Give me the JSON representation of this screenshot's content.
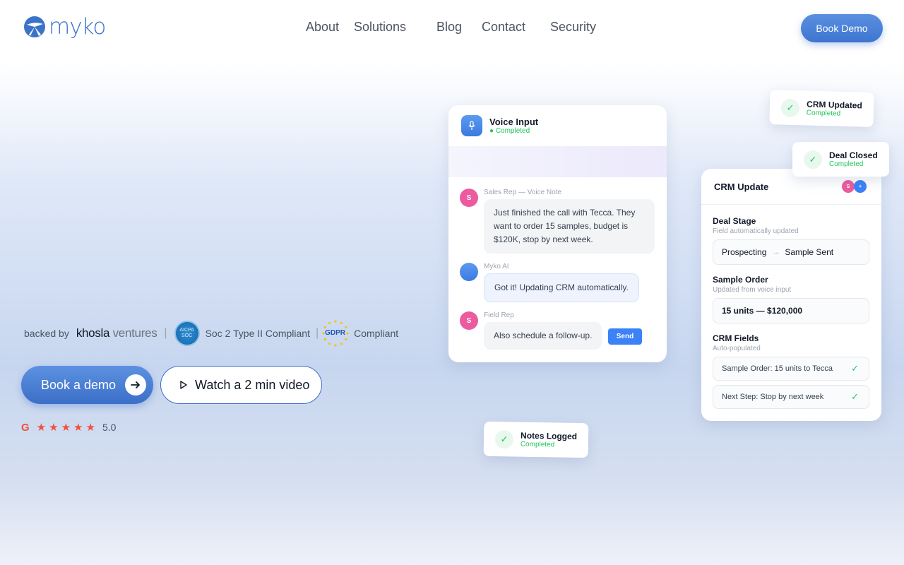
{
  "nav": {
    "logo_text": "myko",
    "items": [
      "About",
      "Solutions",
      "Blog",
      "Contact",
      "Security"
    ],
    "cta": "Book Demo"
  },
  "hero": {
    "backed_by": "backed by",
    "khosla_a": "khosla",
    "khosla_b": "ventures",
    "soc_badge_line1": "AICPA",
    "soc_badge_line2": "SOC",
    "soc_label": "Soc 2  Type  II Compliant",
    "gdpr_badge": "GDPR",
    "gdpr_label": "Compliant",
    "cta_primary": "Book a demo",
    "cta_secondary": "Watch a 2 min video",
    "rating_logo": "G",
    "rating": "5.0",
    "stars": 5
  },
  "chat": {
    "title": "Voice Input",
    "status": "● Completed",
    "messages": [
      {
        "avatar": "S",
        "who": "Sales Rep — Voice Note",
        "text": "Just finished the call with Tecca. They want to order 15 samples, budget is $120K, stop by next week."
      },
      {
        "avatar": "",
        "who": "Myko AI",
        "text": "Got it! Updating CRM automatically."
      },
      {
        "avatar": "S",
        "who": "Field Rep",
        "text": "Also schedule a follow-up."
      }
    ],
    "send": "Send"
  },
  "crm": {
    "title": "CRM Update",
    "avatar_a": "S",
    "avatar_b": "+",
    "deal_stage": {
      "title": "Deal Stage",
      "sub": "Field automatically updated",
      "from": "Prospecting",
      "arrow": "→",
      "to": "Sample Sent"
    },
    "sample_order": {
      "title": "Sample Order",
      "sub": "Updated from voice input",
      "value": "15 units — $120,000"
    },
    "fields": {
      "title": "CRM Fields",
      "sub": "Auto-populated",
      "items": [
        "Sample Order: 15 units to Tecca",
        "Next Step: Stop by next week"
      ]
    }
  },
  "toasts": {
    "crm_updated": {
      "title": "CRM Updated",
      "status": "Completed"
    },
    "deal_closed": {
      "title": "Deal Closed",
      "status": "Completed"
    },
    "notes_logged": {
      "title": "Notes Logged",
      "status": "Completed"
    }
  },
  "colors": {
    "brand": "#3b73c9",
    "accent": "#3b82f6",
    "success": "#22c55e",
    "star": "#ef4f3b"
  }
}
